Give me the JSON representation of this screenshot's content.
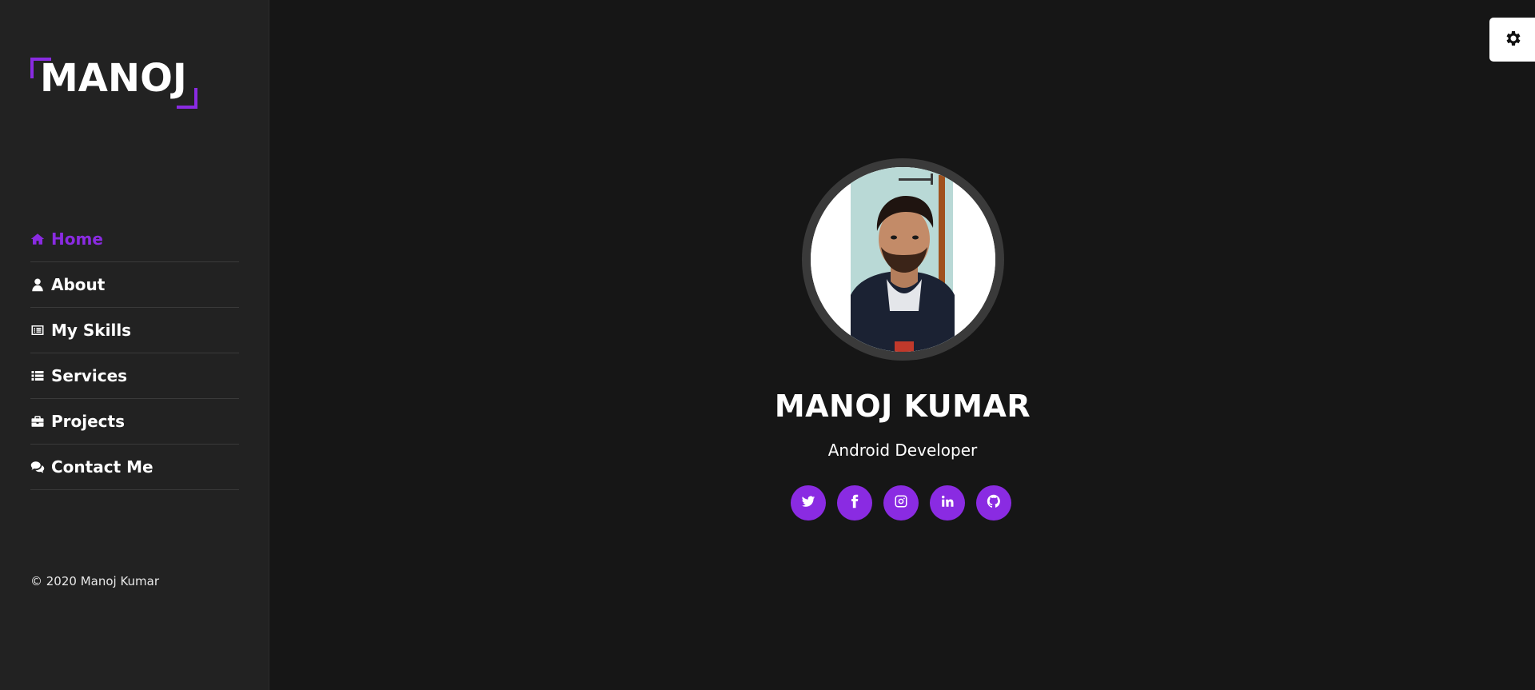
{
  "brand": {
    "logo_text": "MANOJ",
    "accent_color": "#8a2be2"
  },
  "sidebar": {
    "items": [
      {
        "label": "Home",
        "icon": "home-icon",
        "active": true
      },
      {
        "label": "About",
        "icon": "user-icon",
        "active": false
      },
      {
        "label": "My Skills",
        "icon": "list-alt-icon",
        "active": false
      },
      {
        "label": "Services",
        "icon": "list-icon",
        "active": false
      },
      {
        "label": "Projects",
        "icon": "briefcase-icon",
        "active": false
      },
      {
        "label": "Contact Me",
        "icon": "comments-icon",
        "active": false
      }
    ],
    "copyright": "© 2020 Manoj Kumar"
  },
  "profile": {
    "name": "MANOJ KUMAR",
    "role": "Android Developer"
  },
  "socials": [
    {
      "icon": "twitter-icon"
    },
    {
      "icon": "facebook-icon"
    },
    {
      "icon": "instagram-icon"
    },
    {
      "icon": "linkedin-icon"
    },
    {
      "icon": "github-icon"
    }
  ],
  "settings": {
    "icon": "gear-icon"
  },
  "colors": {
    "background": "#161616",
    "sidebar": "#222222",
    "accent": "#8a2be2"
  }
}
